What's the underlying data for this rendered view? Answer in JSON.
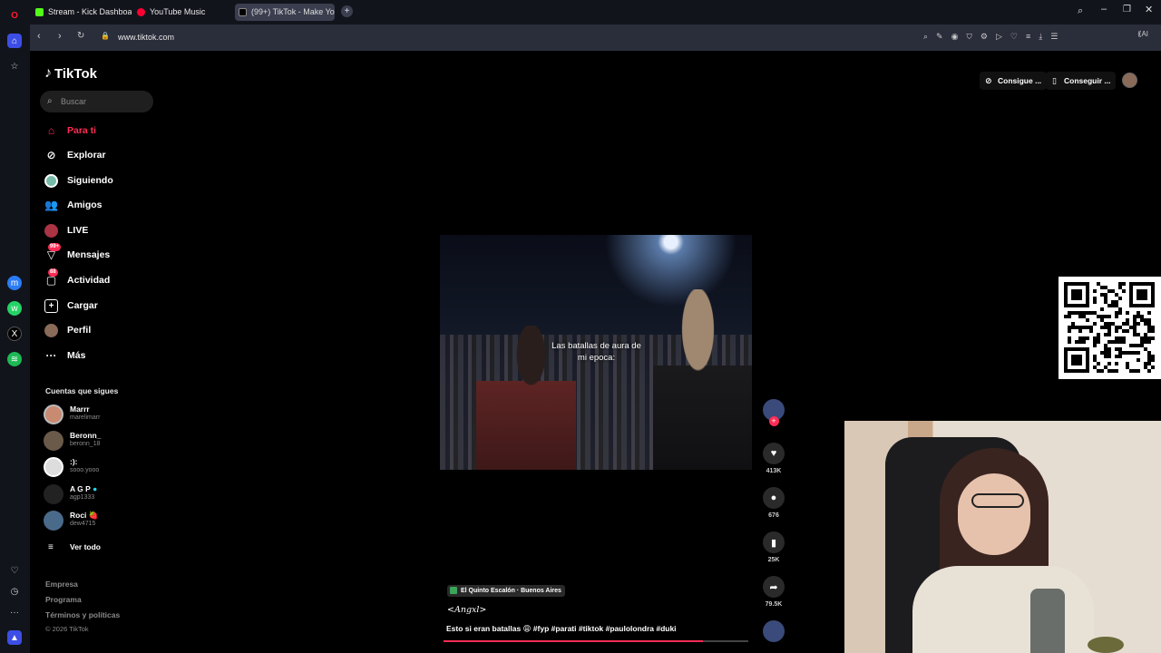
{
  "browser": {
    "tabs": [
      {
        "label": "Stream - Kick Dashboard",
        "color": "#53fc18"
      },
      {
        "label": "YouTube Music",
        "color": "#ff0033"
      },
      {
        "label": "(99+) TikTok - Make Yo",
        "color": "#000000"
      }
    ],
    "url": "www.tiktok.com",
    "ai_label": "AI"
  },
  "tiktok": {
    "logo": "TikTok",
    "search_placeholder": "Buscar",
    "nav": [
      {
        "label": "Para ti",
        "icon": "home-icon",
        "active": true
      },
      {
        "label": "Explorar",
        "icon": "compass-icon"
      },
      {
        "label": "Siguiendo",
        "icon": "following-avatar"
      },
      {
        "label": "Amigos",
        "icon": "friends-icon"
      },
      {
        "label": "LIVE",
        "icon": "live-icon"
      },
      {
        "label": "Mensajes",
        "icon": "message-icon",
        "badge": "99+"
      },
      {
        "label": "Actividad",
        "icon": "activity-icon",
        "badge": "88"
      },
      {
        "label": "Cargar",
        "icon": "upload-icon"
      },
      {
        "label": "Perfil",
        "icon": "profile-avatar"
      },
      {
        "label": "Más",
        "icon": "more-icon"
      }
    ],
    "following_title": "Cuentas que sigues",
    "following": [
      {
        "name": "Marrr",
        "handle": "marelimarr"
      },
      {
        "name": "Beronn_",
        "handle": "beronn_18"
      },
      {
        "name": ":):",
        "handle": "sooo.yooo"
      },
      {
        "name": "A G P",
        "handle": "agp1333"
      },
      {
        "name": "Roci 🍓",
        "handle": "dew4715"
      }
    ],
    "see_all": "Ver todo",
    "footer": [
      "Empresa",
      "Programa",
      "Términos y políticas",
      "© 2026 TikTok"
    ],
    "top_buttons": [
      "Consigue ...",
      "Conseguir ..."
    ]
  },
  "video": {
    "caption": "Las batallas de aura de mi epoca:",
    "likes": "413K",
    "comments": "676",
    "saves": "25K",
    "shares": "79.5K",
    "location": "El Quinto Escalón · Buenos Aires",
    "author": "<Angxl>",
    "description": "Esto si eran batallas 😩 #fyp #parati #tiktok #paulolondra #duki",
    "progress": 0.85
  }
}
